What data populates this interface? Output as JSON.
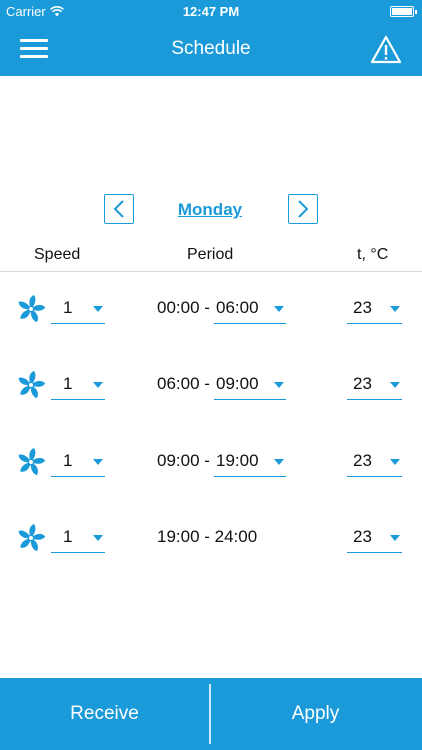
{
  "status": {
    "carrier": "Carrier",
    "time": "12:47 PM"
  },
  "header": {
    "title": "Schedule",
    "menu_icon": "hamburger-menu-icon",
    "warning_icon": "warning-triangle-icon"
  },
  "day_nav": {
    "day": "Monday",
    "prev_icon": "chevron-left-icon",
    "next_icon": "chevron-right-icon"
  },
  "columns": {
    "speed": "Speed",
    "period": "Period",
    "temp": "t, °C"
  },
  "rows": [
    {
      "speed": "1",
      "start": "00:00 -",
      "end": "06:00",
      "temp": "23"
    },
    {
      "speed": "1",
      "start": "06:00 -",
      "end": "09:00",
      "temp": "23"
    },
    {
      "speed": "1",
      "start": "09:00 -",
      "end": "19:00",
      "temp": "23"
    },
    {
      "speed": "1",
      "period_text": "19:00 - 24:00",
      "temp": "23"
    }
  ],
  "footer": {
    "receive": "Receive",
    "apply": "Apply"
  },
  "colors": {
    "accent": "#1a9ad9",
    "background": "#ffffff",
    "divider": "#d8d8d8"
  }
}
